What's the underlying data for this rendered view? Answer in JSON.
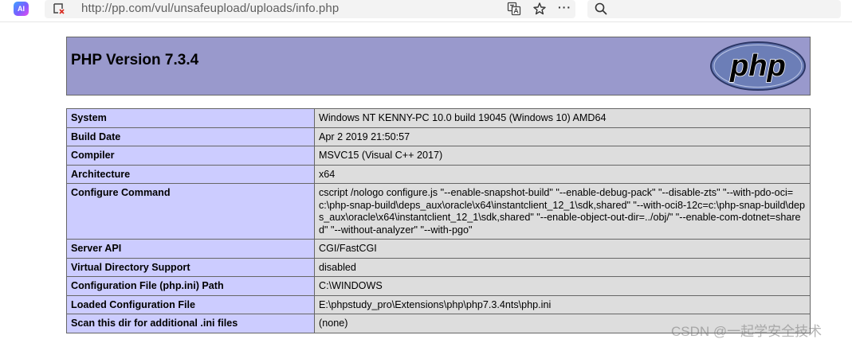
{
  "browser": {
    "ai_label": "AI",
    "url": "http://pp.com/vul/unsafeupload/uploads/info.php",
    "more_glyph": "···"
  },
  "phpinfo": {
    "title": "PHP Version 7.3.4",
    "logo_text": "php",
    "rows": [
      {
        "label": "System",
        "value": "Windows NT KENNY-PC 10.0 build 19045 (Windows 10) AMD64"
      },
      {
        "label": "Build Date",
        "value": "Apr 2 2019 21:50:57"
      },
      {
        "label": "Compiler",
        "value": "MSVC15 (Visual C++ 2017)"
      },
      {
        "label": "Architecture",
        "value": "x64"
      },
      {
        "label": "Configure Command",
        "value": "cscript /nologo configure.js \"--enable-snapshot-build\" \"--enable-debug-pack\" \"--disable-zts\" \"--with-pdo-oci=c:\\php-snap-build\\deps_aux\\oracle\\x64\\instantclient_12_1\\sdk,shared\" \"--with-oci8-12c=c:\\php-snap-build\\deps_aux\\oracle\\x64\\instantclient_12_1\\sdk,shared\" \"--enable-object-out-dir=../obj/\" \"--enable-com-dotnet=shared\" \"--without-analyzer\" \"--with-pgo\""
      },
      {
        "label": "Server API",
        "value": "CGI/FastCGI"
      },
      {
        "label": "Virtual Directory Support",
        "value": "disabled"
      },
      {
        "label": "Configuration File (php.ini) Path",
        "value": "C:\\WINDOWS"
      },
      {
        "label": "Loaded Configuration File",
        "value": "E:\\phpstudy_pro\\Extensions\\php\\php7.3.4nts\\php.ini"
      },
      {
        "label": "Scan this dir for additional .ini files",
        "value": "(none)"
      }
    ]
  },
  "watermark": "CSDN @一起学安全技术"
}
